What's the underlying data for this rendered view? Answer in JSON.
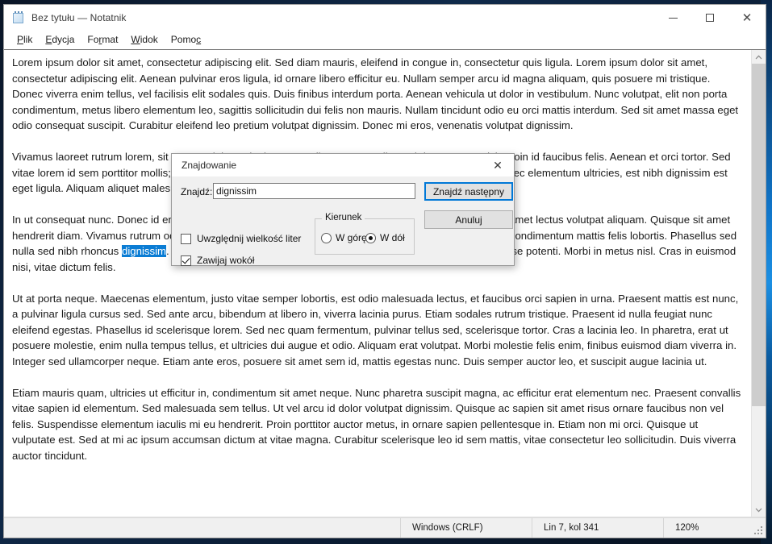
{
  "window": {
    "title": "Bez tytułu — Notatnik",
    "icon": "notepad-icon",
    "controls": {
      "minimize": "minimize-icon",
      "maximize": "maximize-icon",
      "close": "close-icon"
    }
  },
  "menu": {
    "items": [
      {
        "label": "Plik",
        "accel": "P",
        "rest": "lik"
      },
      {
        "label": "Edycja",
        "accel": "E",
        "rest": "dycja"
      },
      {
        "label": "Format",
        "accel": "r",
        "rest": "Format"
      },
      {
        "label": "Widok",
        "accel": "W",
        "rest": "idok"
      },
      {
        "label": "Pomoc",
        "accel": "c",
        "rest": "Pomoc"
      }
    ]
  },
  "editor": {
    "paragraphs": [
      {
        "before": "Lorem ipsum dolor sit amet, consectetur adipiscing elit. Sed diam mauris, eleifend in congue in, consectetur quis ligula. Lorem ipsum dolor sit amet, consectetur adipiscing elit. Aenean pulvinar eros ligula, id ornare libero efficitur eu. Nullam semper arcu id magna aliquam, quis posuere mi tristique. Donec viverra enim tellus, vel facilisis elit sodales quis. Duis finibus interdum porta. Aenean vehicula ut dolor in vestibulum. Nunc volutpat, elit non porta condimentum, metus libero elementum leo, sagittis sollicitudin dui felis non mauris. Nullam tincidunt odio eu orci mattis interdum. Sed sit amet massa eget odio consequat suscipit. Curabitur eleifend leo pretium volutpat dignissim. Donec mi eros, venenatis volutpat dignissim.",
        "match": "",
        "after": ""
      },
      {
        "before": "Vivamus laoreet rutrum lorem, sit amet sodales enim luctus et. Aliquam erat velit et, ultrices tempor nisi. Proin id faucibus felis. Aenean et orci tortor. Sed vitae lorem id sem porttitor mollis; id nisl nec nibh sollicitudin efficitur vel vitae sem. Cras malesuada, nisi nec elementum ultricies, est nibh dignissim est eget ligula. Aliquam aliquet malesuada purus.",
        "match": "",
        "after": ""
      },
      {
        "before": "In ut consequat nunc. Donec id enim a ante fringilla bibendum blandit sed orci. Maecenas sagittis velit sit amet lectus volutpat aliquam. Quisque sit amet hendrerit diam. Vivamus rutrum odio eget suscipit pulvinar. Maecenas ullamcorper erat at lorem posuere, condimentum mattis felis lobortis. Phasellus sed nulla sed nibh rhoncus ",
        "match": "dignissim",
        "after": ". Praesent dapibus convallis leo, vel ultricies urna varius vitae. Suspendisse potenti. Morbi in metus nisl. Cras in euismod nisi, vitae dictum felis."
      },
      {
        "before": "Ut at porta neque. Maecenas elementum, justo vitae semper lobortis, est odio malesuada lectus, et faucibus orci sapien in urna. Praesent mattis est nunc, a pulvinar ligula cursus sed. Sed ante arcu, bibendum at libero in, viverra lacinia purus. Etiam sodales rutrum tristique. Praesent id nulla feugiat nunc eleifend egestas. Phasellus id scelerisque lorem. Sed nec quam fermentum, pulvinar tellus sed, scelerisque tortor. Cras a lacinia leo. In pharetra, erat ut posuere molestie, enim nulla tempus tellus, et ultricies dui augue et odio. Aliquam erat volutpat. Morbi molestie felis enim, finibus euismod diam viverra in. Integer sed ullamcorper neque. Etiam ante eros, posuere sit amet sem id, mattis egestas nunc. Duis semper auctor leo, et suscipit augue lacinia ut.",
        "match": "",
        "after": ""
      },
      {
        "before": "Etiam mauris quam, ultricies ut efficitur in, condimentum sit amet neque. Nunc pharetra suscipit magna, ac efficitur erat elementum nec. Praesent convallis vitae sapien id elementum. Sed malesuada sem tellus. Ut vel arcu id dolor volutpat dignissim. Quisque ac sapien sit amet risus ornare faucibus non vel felis. Suspendisse elementum iaculis mi eu hendrerit. Proin porttitor auctor metus, in ornare sapien pellentesque in. Etiam non mi orci. Quisque ut vulputate est. Sed at mi ac ipsum accumsan dictum at vitae magna. Curabitur scelerisque leo id sem mattis, vitae consectetur leo sollicitudin. Duis viverra auctor tincidunt.",
        "match": "",
        "after": ""
      }
    ],
    "scrollbar": {
      "up_arrow": "chevron-up-icon",
      "down_arrow": "chevron-down-icon"
    }
  },
  "status_bar": {
    "eol": "Windows (CRLF)",
    "position": "Lin 7, kol 341",
    "zoom": "120%"
  },
  "find_dialog": {
    "title": "Znajdowanie",
    "close_icon": "close-icon",
    "find_label": "Znajdź:",
    "find_value": "dignissim",
    "find_placeholder": "",
    "find_next_label": "Znajdź następny",
    "cancel_label": "Anuluj",
    "match_case_label": "Uwzględnij wielkość liter",
    "match_case_checked": false,
    "wrap_around_label": "Zawijaj wokół",
    "wrap_around_checked": true,
    "direction_legend": "Kierunek",
    "direction_up_label": "W górę",
    "direction_down_label": "W dół",
    "direction_selected": "down"
  },
  "colors": {
    "accent": "#0078d7",
    "selection": "#0a7cd4",
    "window_bg": "#ffffff",
    "dialog_bg": "#f0f0f0",
    "status_bg": "#f0f0f0"
  }
}
